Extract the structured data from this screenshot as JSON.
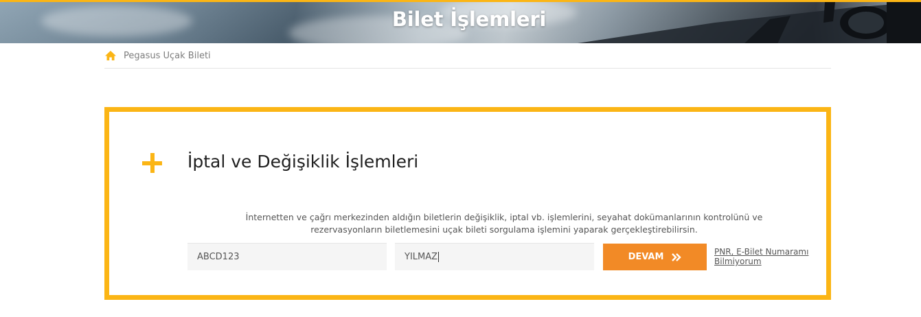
{
  "hero": {
    "title": "Bilet İşlemleri"
  },
  "breadcrumb": {
    "icon": "home-icon",
    "items": [
      "Pegasus Uçak Bileti"
    ]
  },
  "panel": {
    "icon": "plus-icon",
    "title": "İptal ve Değişiklik İşlemleri",
    "description_line1": "İnternetten ve çağrı merkezinden aldığın biletlerin değişiklik, iptal vb. işlemlerini, seyahat dokümanlarının kontrolünü ve",
    "description_line2": "rezervasyonların biletlemesini uçak bileti sorgulama işlemini yaparak gerçekleştirebilirsin.",
    "pnr_field": {
      "value": "ABCD123"
    },
    "surname_field": {
      "value": "YILMAZ"
    },
    "submit_label": "DEVAM",
    "submit_icon": "double-chevron-right-icon",
    "help_link_line1": "PNR, E-Bilet Numaramı",
    "help_link_line2": "Bilmiyorum"
  },
  "colors": {
    "accent_yellow": "#fbb515",
    "button_orange": "#f28a26"
  }
}
